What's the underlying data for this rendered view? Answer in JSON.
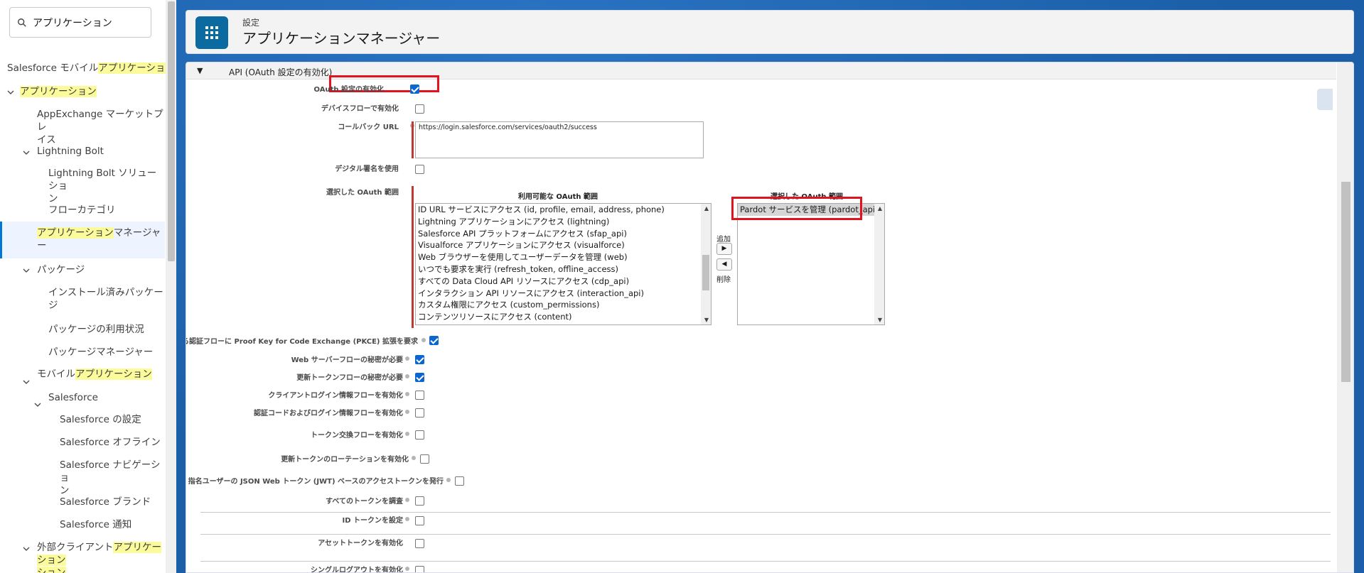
{
  "search": {
    "value": "アプリケーション"
  },
  "sidebar": {
    "items": [
      {
        "prefix": "Salesforce モバイル",
        "highlight": "アプリケーション",
        "suffix": ""
      },
      {
        "prefix": "",
        "highlight": "アプリケーション",
        "suffix": ""
      },
      {
        "label_line1": "AppExchange マーケットプレ",
        "label_line2": "イス"
      },
      {
        "label": "Lightning Bolt"
      },
      {
        "label_line1": "Lightning Bolt ソリューショ",
        "label_line2": "ン"
      },
      {
        "label": "フローカテゴリ"
      },
      {
        "highlight": "アプリケーション",
        "suffix": "マネージャ",
        "line2": "ー"
      },
      {
        "label": "パッケージ"
      },
      {
        "label_line1": "インストール済みパッケー",
        "label_line2": "ジ"
      },
      {
        "label": "パッケージの利用状況"
      },
      {
        "label": "パッケージマネージャー"
      },
      {
        "prefix": "モバイル",
        "highlight": "アプリケーション"
      },
      {
        "label": "Salesforce"
      },
      {
        "label": "Salesforce の設定"
      },
      {
        "label": "Salesforce オフライン"
      },
      {
        "label_line1": "Salesforce ナビゲーショ",
        "label_line2": "ン"
      },
      {
        "label": "Salesforce ブランド"
      },
      {
        "label": "Salesforce 通知"
      },
      {
        "prefix": "外部クライアント",
        "highlight": "アプリケーション",
        "line2": "ション"
      }
    ]
  },
  "header": {
    "subtitle": "設定",
    "title": "アプリケーションマネージャー"
  },
  "section": {
    "title": "API (OAuth 設定の有効化)"
  },
  "form": {
    "enable_oauth": {
      "label": "OAuth 設定の有効化",
      "checked": true
    },
    "device_flow": {
      "label": "デバイスフローで有効化",
      "checked": false
    },
    "callback": {
      "label": "コールバック URL",
      "value": "https://login.salesforce.com/services/oauth2/success"
    },
    "digital_sig": {
      "label": "デジタル署名を使用",
      "checked": false
    },
    "scopes": {
      "label": "選択した OAuth 範囲",
      "available_header": "利用可能な OAuth 範囲",
      "selected_header": "選択した OAuth 範囲",
      "add": "追加",
      "remove": "削除",
      "available": [
        "ID URL サービスにアクセス (id, profile, email, address, phone)",
        "Lightning アプリケーションにアクセス (lightning)",
        "Salesforce API プラットフォームにアクセス (sfap_api)",
        "Visualforce アプリケーションにアクセス (visualforce)",
        "Web ブラウザーを使用してユーザーデータを管理 (web)",
        "いつでも要求を実行 (refresh_token, offline_access)",
        "すべての Data Cloud API リソースにアクセス (cdp_api)",
        "インタラクション API リソースにアクセス (interaction_api)",
        "カスタム権限にアクセス (custom_permissions)",
        "コンテンツリソースにアクセス (content)"
      ],
      "selected": [
        "Pardot サービスを管理 (pardot_api)"
      ]
    },
    "pkce": {
      "label": "サポートされる認証フローに Proof Key for Code Exchange (PKCE) 拡張を要求",
      "checked": true
    },
    "web_server_secret": {
      "label": "Web サーバーフローの秘密が必要",
      "checked": true
    },
    "refresh_secret": {
      "label": "更新トークンフローの秘密が必要",
      "checked": true
    },
    "client_login": {
      "label": "クライアントログイン情報フローを有効化",
      "checked": false
    },
    "auth_code": {
      "label": "認証コードおよびログイン情報フローを有効化",
      "checked": false
    },
    "token_exchange": {
      "label": "トークン交換フローを有効化",
      "checked": false
    },
    "refresh_rotation": {
      "label": "更新トークンのローテーションを有効化",
      "checked": false
    },
    "jwt": {
      "label": "指名ユーザーの JSON Web トークン (JWT) ベースのアクセストークンを発行",
      "checked": false
    },
    "introspect": {
      "label": "すべてのトークンを調査",
      "checked": false
    },
    "id_token": {
      "label": "ID トークンを設定",
      "checked": false
    },
    "asset_token": {
      "label": "アセットトークンを有効化",
      "checked": false
    },
    "single_logout": {
      "label": "シングルログアウトを有効化",
      "checked": false
    }
  }
}
